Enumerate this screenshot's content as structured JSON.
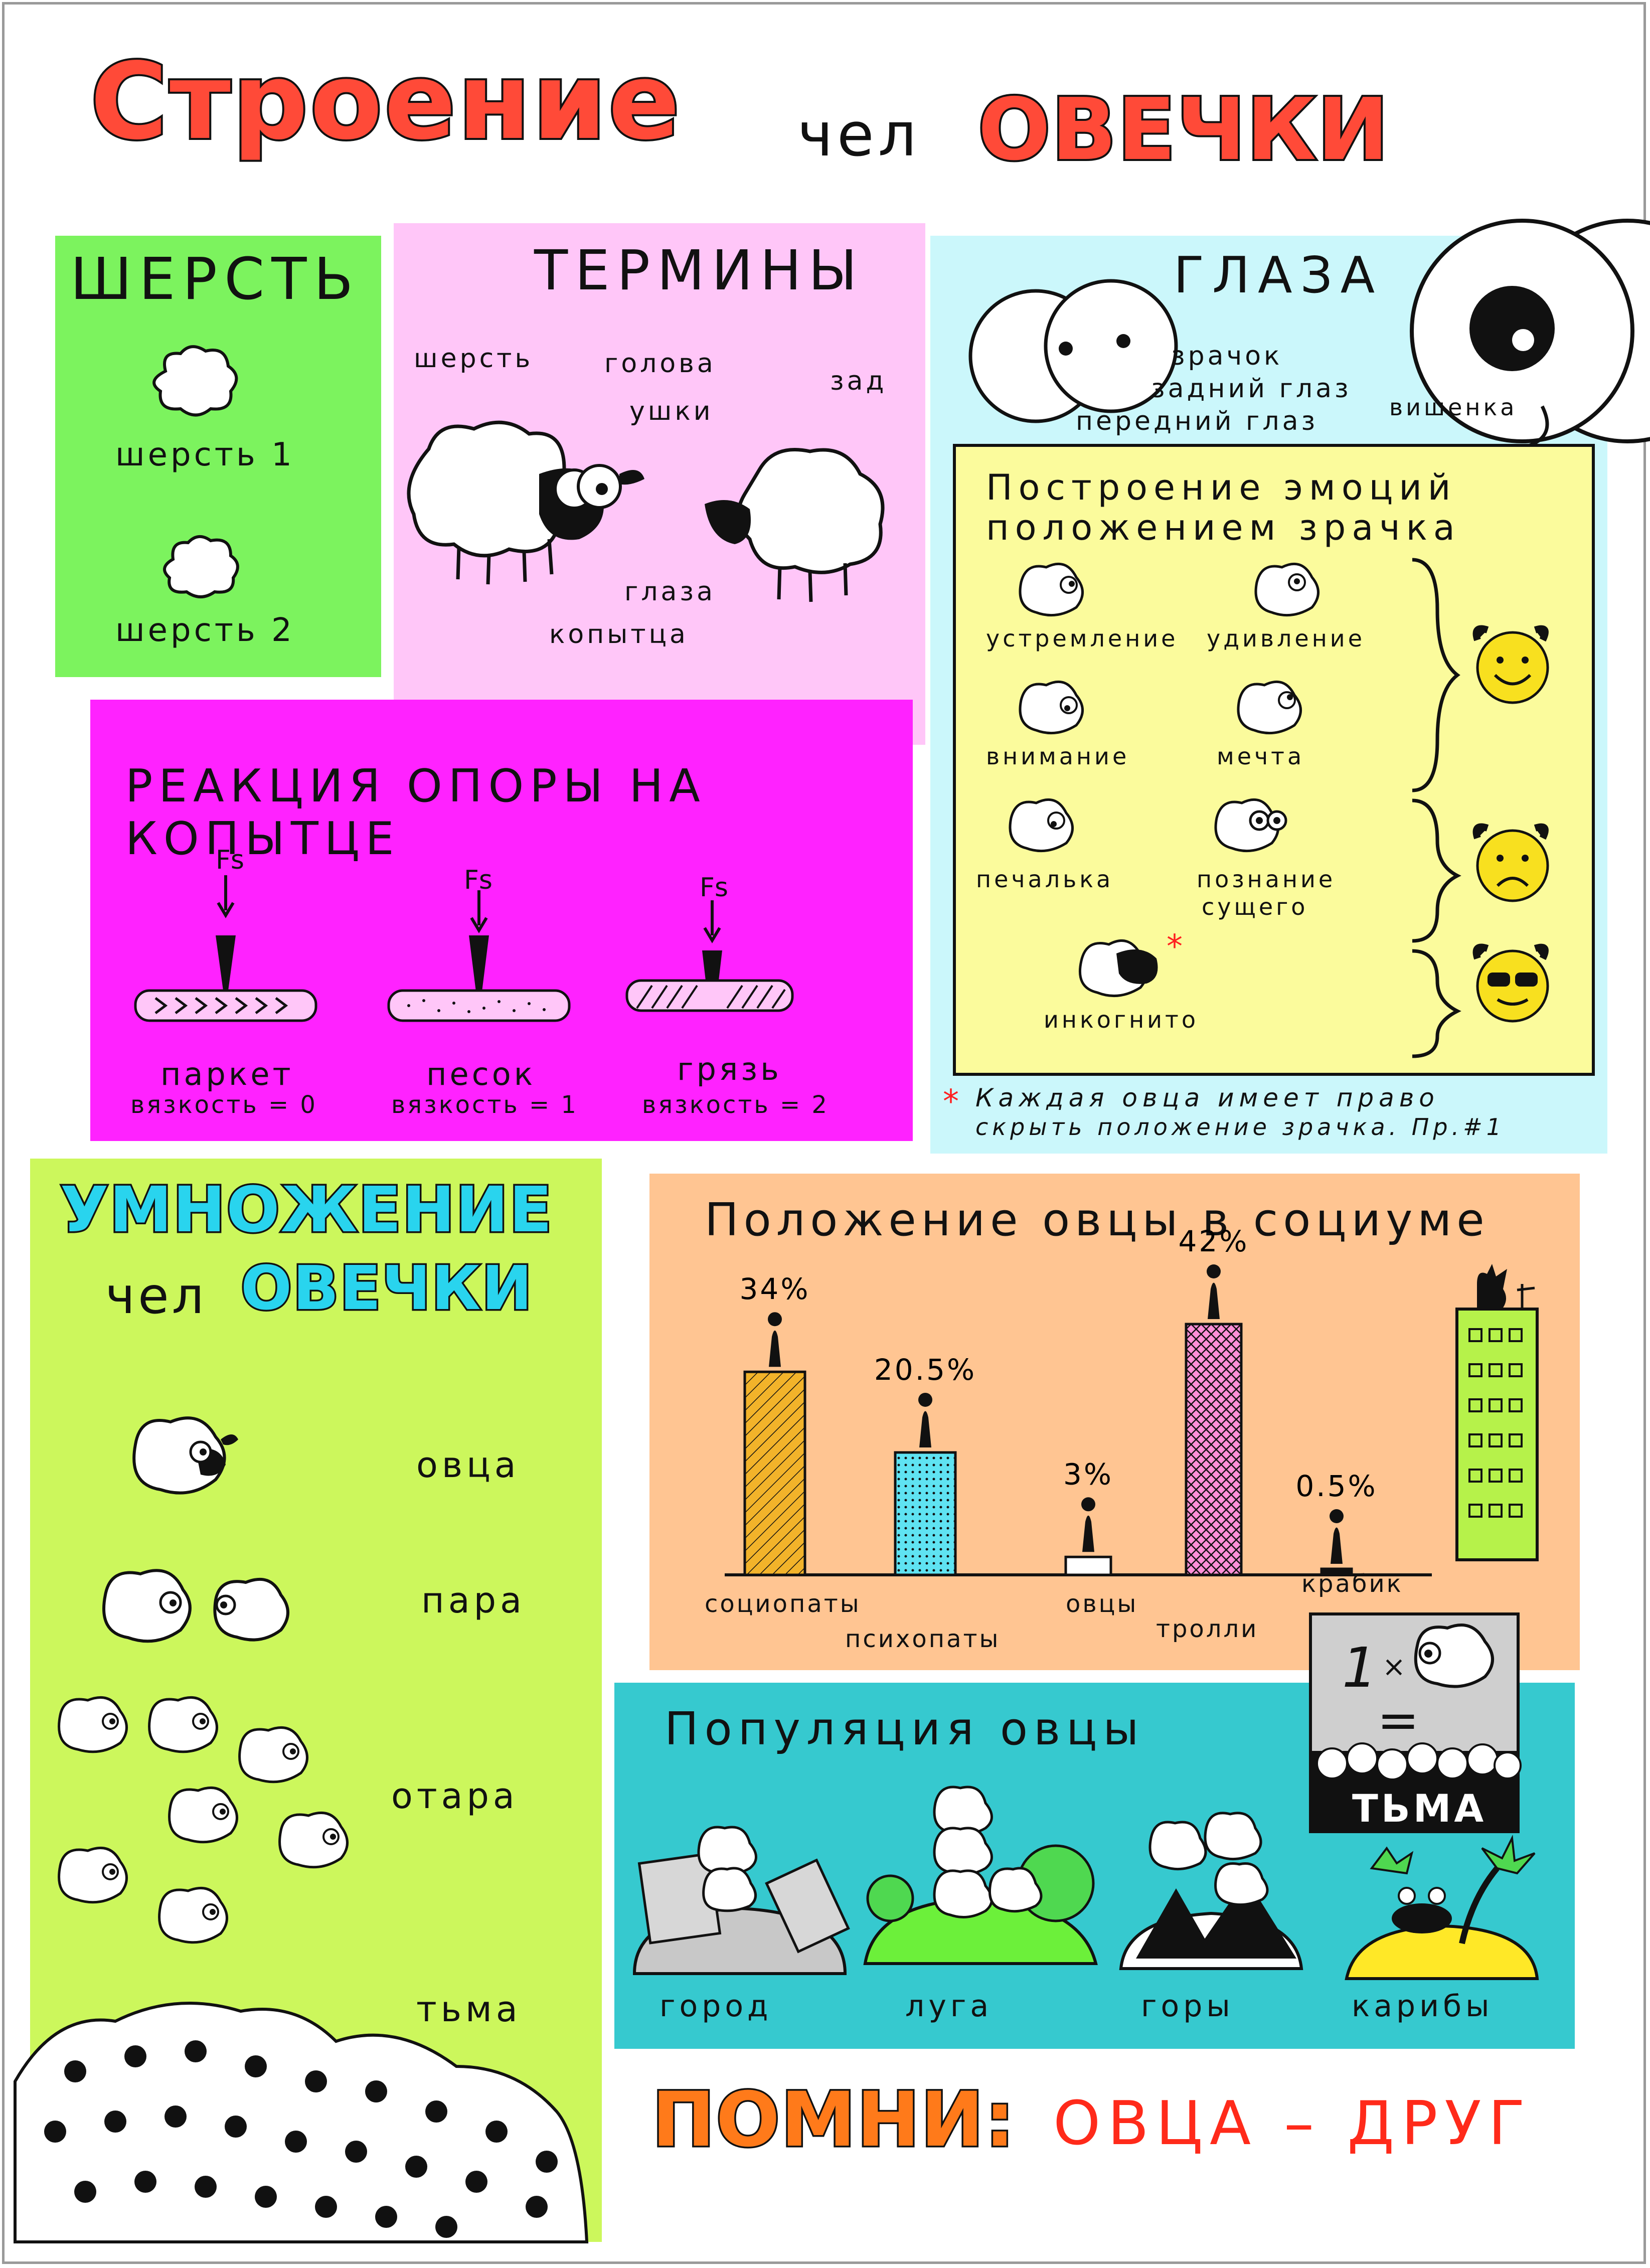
{
  "title": {
    "part1": "Строение",
    "part2_small": "чел",
    "part2_big": "ОВЕЧКИ"
  },
  "colors": {
    "green": "#7cf35e",
    "pink": "#ffc6f8",
    "cyan": "#cbf7fb",
    "magenta": "#ff22ff",
    "yellow": "#fbfb9c",
    "lime": "#ccf75c",
    "peach": "#ffc592",
    "teal": "#36c9cf",
    "red": "#ff4a38",
    "accent_cyan": "#29d4ee",
    "orange": "#ff7a1a"
  },
  "wool": {
    "title": "ШЕРСТЬ",
    "item1": "шерсть 1",
    "item2": "шерсть 2"
  },
  "terms": {
    "title": "ТЕРМИНЫ",
    "wool": "шерсть",
    "head": "голова",
    "ears": "ушки",
    "back": "зад",
    "eyes": "глаза",
    "hooves": "копытца"
  },
  "eyes": {
    "title": "ГЛАЗА",
    "pupil": "зрачок",
    "rear_eye": "задний глаз",
    "front_eye": "передний глаз",
    "cherry": "вишенка"
  },
  "emotions": {
    "title_line1": "Построение эмоций",
    "title_line2": "положением зрачка",
    "items": [
      "устремление",
      "удивление",
      "внимание",
      "мечта",
      "печалька",
      "познание",
      "сущего",
      "инкогнито"
    ],
    "footnote_mark": "*",
    "footnote_line1": "Каждая овца имеет право",
    "footnote_line2": "скрыть положение зрачка. Пр.#1"
  },
  "reaction": {
    "title": "РЕАКЦИЯ ОПОРЫ НА КОПЫТЦЕ",
    "force_label": "Fs",
    "surfaces": [
      {
        "name": "паркет",
        "viscosity": "вязкость = 0"
      },
      {
        "name": "песок",
        "viscosity": "вязкость = 1"
      },
      {
        "name": "грязь",
        "viscosity": "вязкость = 2"
      }
    ]
  },
  "multiply": {
    "title_line1": "УМНОЖЕНИЕ",
    "title_small": "чел",
    "title_big": "ОВЕЧКИ",
    "items": [
      "овца",
      "пара",
      "отара",
      "тьма"
    ]
  },
  "social": {
    "title": "Положение овцы в социуме",
    "bars": [
      {
        "label": "социопаты",
        "value_text": "34%",
        "value": 34,
        "color": "#f2b32a",
        "pattern": "hatch"
      },
      {
        "label": "психопаты",
        "value_text": "20.5%",
        "value": 20.5,
        "color": "#5fe3f2",
        "pattern": "dots"
      },
      {
        "label": "овцы",
        "value_text": "3%",
        "value": 3,
        "color": "#ffffff",
        "pattern": "none"
      },
      {
        "label": "тролли",
        "value_text": "42%",
        "value": 42,
        "color": "#ff8fd8",
        "pattern": "cross"
      },
      {
        "label": "крабик",
        "value_text": "0.5%",
        "value": 0.5,
        "color": "#111111",
        "pattern": "none"
      }
    ]
  },
  "population": {
    "title": "Популяция овцы",
    "places": [
      "город",
      "луга",
      "горы",
      "карибы"
    ],
    "equation_one": "1",
    "equation_times": "×",
    "equation_eq": "=",
    "equation_result": "ТЬМА"
  },
  "footer": {
    "remember": "ПОМНИ:",
    "motto": "ОВЦА – ДРУГ"
  }
}
